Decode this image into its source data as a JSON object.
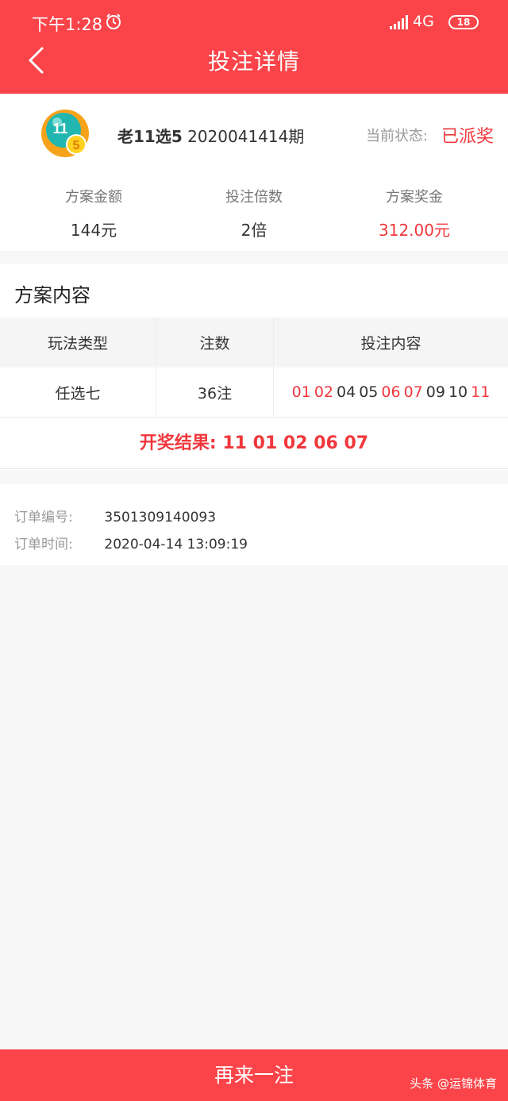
{
  "status_bar": {
    "time": "下午1:28",
    "network": "4G",
    "battery": "18"
  },
  "header": {
    "title": "投注详情"
  },
  "summary": {
    "lottery_name": "老11选5",
    "issue": "2020041414期",
    "status_label": "当前状态:",
    "status_value": "已派奖",
    "logo_text": "11",
    "logo_badge": "5",
    "stats": [
      {
        "label": "方案金额",
        "value": "144元"
      },
      {
        "label": "投注倍数",
        "value": "2倍"
      },
      {
        "label": "方案奖金",
        "value": "312.00元"
      }
    ]
  },
  "plan": {
    "title": "方案内容",
    "columns": [
      "玩法类型",
      "注数",
      "投注内容"
    ],
    "rows": [
      {
        "type": "任选七",
        "count": "36注",
        "numbers": [
          "01",
          "02",
          "04",
          "05",
          "06",
          "07",
          "09",
          "10",
          "11"
        ]
      }
    ],
    "result_label": "开奖结果:",
    "result_numbers": "11 01 02 06 07"
  },
  "order": {
    "number_label": "订单编号:",
    "number_value": "3501309140093",
    "time_label": "订单时间:",
    "time_value": "2020-04-14 13:09:19"
  },
  "footer": {
    "button_label": "再来一注",
    "watermark": "头条 @运锦体育"
  },
  "colors": {
    "brand": "#fa4449",
    "hit": "#f0383d"
  }
}
